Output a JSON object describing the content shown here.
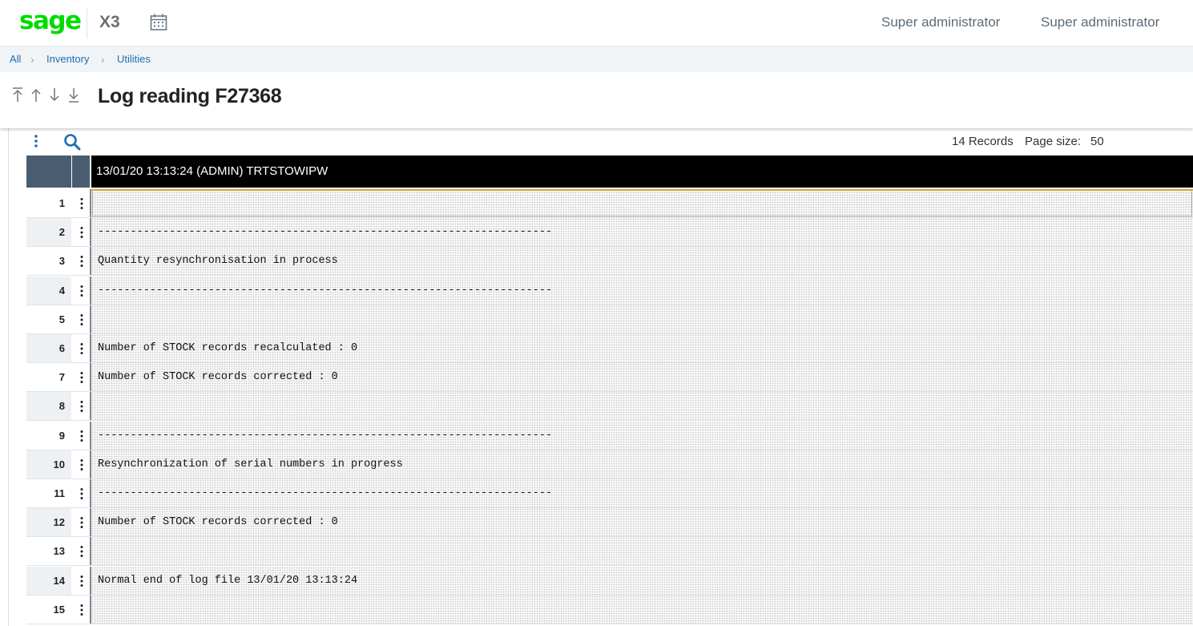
{
  "header": {
    "logo": "sage",
    "product": "X3",
    "users": [
      "Super administrator",
      "Super administrator"
    ]
  },
  "breadcrumb": [
    "All",
    "Inventory",
    "Utilities"
  ],
  "page": {
    "title": "Log reading F27368"
  },
  "toolbar": {
    "records": "14 Records",
    "page_size_label": "Page size:",
    "page_size_value": "50"
  },
  "grid": {
    "column_header": "13/01/20 13:13:24 (ADMIN) TRTSTOWIPW",
    "rows": [
      {
        "num": "1",
        "text": ""
      },
      {
        "num": "2",
        "text": "----------------------------------------------------------------------"
      },
      {
        "num": "3",
        "text": "Quantity resynchronisation in process"
      },
      {
        "num": "4",
        "text": "----------------------------------------------------------------------"
      },
      {
        "num": "5",
        "text": ""
      },
      {
        "num": "6",
        "text": "Number of STOCK records recalculated : 0"
      },
      {
        "num": "7",
        "text": "Number of STOCK records corrected : 0"
      },
      {
        "num": "8",
        "text": ""
      },
      {
        "num": "9",
        "text": "----------------------------------------------------------------------"
      },
      {
        "num": "10",
        "text": "Resynchronization of serial numbers in progress"
      },
      {
        "num": "11",
        "text": "----------------------------------------------------------------------"
      },
      {
        "num": "12",
        "text": "Number of STOCK records corrected : 0"
      },
      {
        "num": "13",
        "text": ""
      },
      {
        "num": "14",
        "text": "Normal end of log file 13/01/20 13:13:24"
      },
      {
        "num": "15",
        "text": ""
      }
    ]
  },
  "icons": {
    "calendar": "calendar-icon",
    "first": "first-record-icon",
    "previous": "previous-record-icon",
    "next": "next-record-icon",
    "last": "last-record-icon",
    "actions": "kebab-menu-icon",
    "search": "search-icon"
  },
  "colors": {
    "brand": "#00dc00",
    "link": "#1c6fb5",
    "grid_header": "#000000",
    "grid_header_side": "#4a5d70",
    "search_icon": "#1c6fb5"
  }
}
